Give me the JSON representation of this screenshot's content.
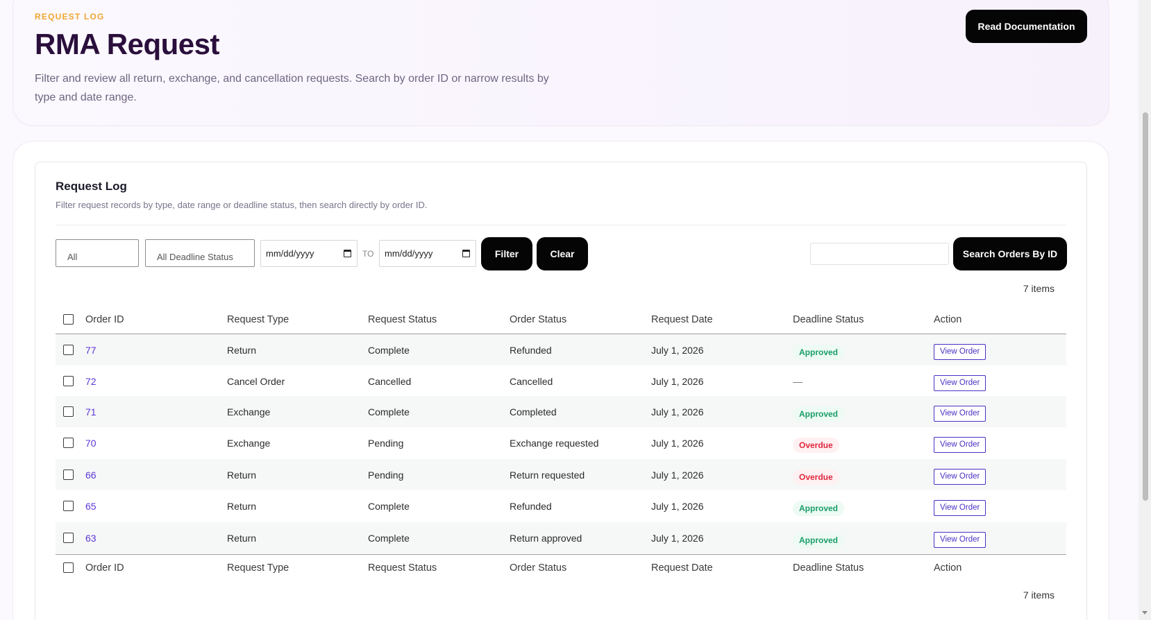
{
  "hero": {
    "eyebrow": "REQUEST LOG",
    "title": "RMA Request",
    "description": "Filter and review all return, exchange, and cancellation requests. Search by order ID or narrow results by type and date range.",
    "doc_button": "Read Documentation"
  },
  "panel": {
    "title": "Request Log",
    "subtitle": "Filter request records by type, date range or deadline status, then search directly by order ID."
  },
  "filters": {
    "type_select": "All",
    "deadline_select": "All Deadline Status",
    "date_from": "mm/dd/yyyy",
    "to_label": "TO",
    "date_to": "mm/dd/yyyy",
    "filter_button": "Filter",
    "clear_button": "Clear",
    "search_value": "",
    "search_button": "Search Orders By ID"
  },
  "items_count_top": "7 items",
  "items_count_bottom": "7 items",
  "columns": [
    "Order ID",
    "Request Type",
    "Request Status",
    "Order Status",
    "Request Date",
    "Deadline Status",
    "Action"
  ],
  "rows": [
    {
      "order_id": "77",
      "request_type": "Return",
      "request_status": "Complete",
      "order_status": "Refunded",
      "request_date": "July 1, 2026",
      "deadline": "Approved",
      "action": "View Order"
    },
    {
      "order_id": "72",
      "request_type": "Cancel Order",
      "request_status": "Cancelled",
      "order_status": "Cancelled",
      "request_date": "July 1, 2026",
      "deadline": "—",
      "action": "View Order"
    },
    {
      "order_id": "71",
      "request_type": "Exchange",
      "request_status": "Complete",
      "order_status": "Completed",
      "request_date": "July 1, 2026",
      "deadline": "Approved",
      "action": "View Order"
    },
    {
      "order_id": "70",
      "request_type": "Exchange",
      "request_status": "Pending",
      "order_status": "Exchange requested",
      "request_date": "July 1, 2026",
      "deadline": "Overdue",
      "action": "View Order"
    },
    {
      "order_id": "66",
      "request_type": "Return",
      "request_status": "Pending",
      "order_status": "Return requested",
      "request_date": "July 1, 2026",
      "deadline": "Overdue",
      "action": "View Order"
    },
    {
      "order_id": "65",
      "request_type": "Return",
      "request_status": "Complete",
      "order_status": "Refunded",
      "request_date": "July 1, 2026",
      "deadline": "Approved",
      "action": "View Order"
    },
    {
      "order_id": "63",
      "request_type": "Return",
      "request_status": "Complete",
      "order_status": "Return approved",
      "request_date": "July 1, 2026",
      "deadline": "Approved",
      "action": "View Order"
    }
  ],
  "colors": {
    "accent": "#f0a631",
    "title": "#2a0f3c",
    "link": "#5b36d6",
    "approved": "#1a9e6a",
    "overdue": "#e0283d",
    "button": "#050505"
  }
}
